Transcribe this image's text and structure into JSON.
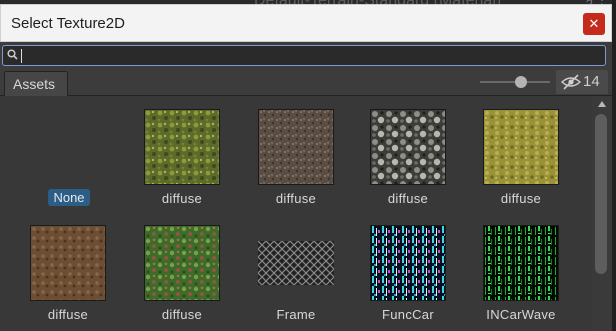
{
  "background": {
    "title_fragment": "Default-Terrain-Standard (Material)"
  },
  "window": {
    "title": "Select Texture2D",
    "close_symbol": "✕"
  },
  "search": {
    "value": "",
    "placeholder": ""
  },
  "toolbar": {
    "tab_label": "Assets",
    "hidden_count": "14"
  },
  "items": [
    {
      "label": "None",
      "texture": "none"
    },
    {
      "label": "diffuse",
      "texture": "moss-grass"
    },
    {
      "label": "diffuse",
      "texture": "gravel-dirt"
    },
    {
      "label": "diffuse",
      "texture": "rocky-gray"
    },
    {
      "label": "diffuse",
      "texture": "dry-grass-yellow"
    },
    {
      "label": "diffuse",
      "texture": "brown-dirt"
    },
    {
      "label": "diffuse",
      "texture": "green-grass-leaves"
    },
    {
      "label": "Frame",
      "texture": "mesh-frame"
    },
    {
      "label": "FuncCar",
      "texture": "cyan-glitch"
    },
    {
      "label": "INCarWave",
      "texture": "green-glitch"
    }
  ]
}
